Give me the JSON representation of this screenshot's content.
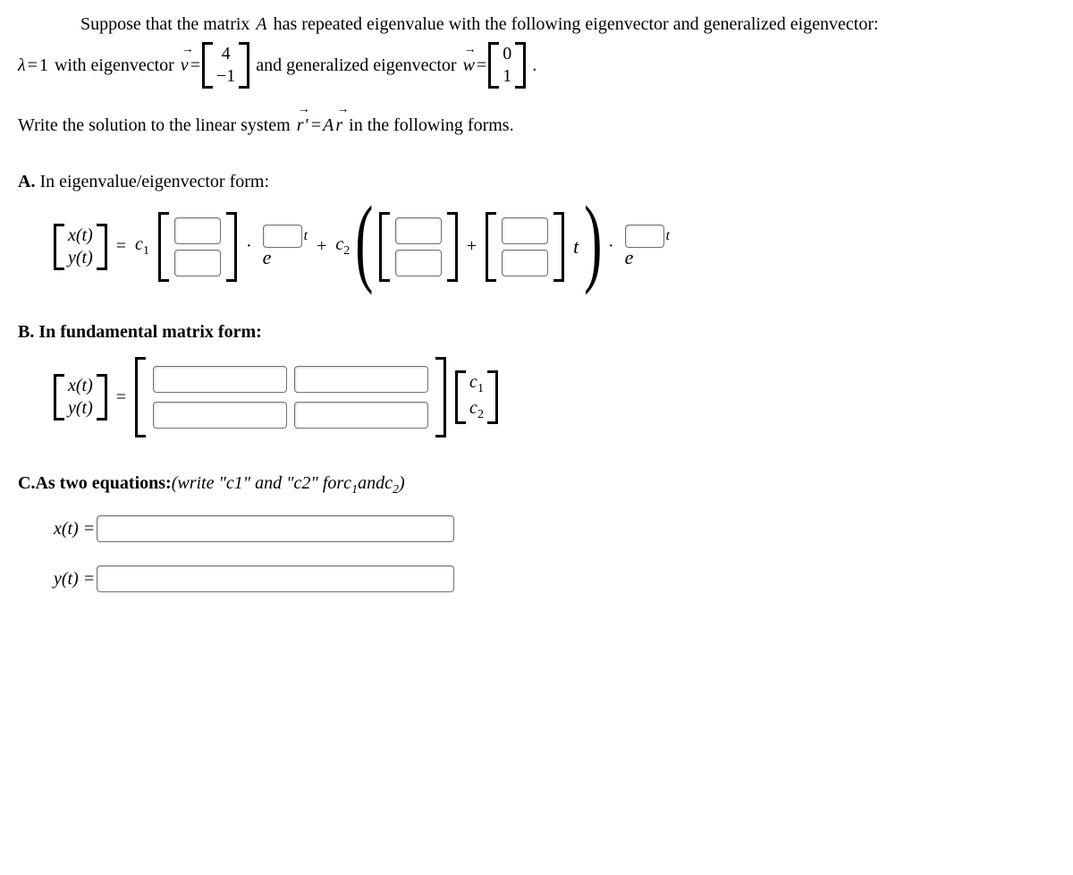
{
  "intro": {
    "l1a": "Suppose that the matrix ",
    "A": "A",
    "l1b": " has repeated eigenvalue with the following eigenvector and generalized eigenvector:",
    "lambda": "λ",
    "eq": " = ",
    "one": "1",
    "witheig": " with eigenvector ",
    "v": "v",
    "eq2": " = ",
    "v1": "4",
    "v2": "−1",
    "andgen": " and generalized eigenvector ",
    "w": "w",
    "eq3": " = ",
    "w1": "0",
    "w2": "1",
    "dot": " ."
  },
  "write": {
    "a": "Write the solution to the linear system ",
    "r": "r",
    "prime": " ′",
    "eq": " = ",
    "Ar": "A",
    "r2": "r",
    "b": " in the following forms."
  },
  "partA": {
    "head_bold": "A.",
    "head_rest": " In eigenvalue/eigenvector form:",
    "x": "x(t)",
    "y": "y(t)",
    "eq": " = ",
    "c1": "c",
    "c1s": "1",
    "dot": " · ",
    "e": "e",
    "t": "t",
    "plus": " + ",
    "c2": "c",
    "c2s": "2",
    "plusin": " + ",
    "tmid": "t"
  },
  "partB": {
    "head_bold": "B.",
    "head_rest": " In fundamental matrix form:",
    "x": "x(t)",
    "y": "y(t)",
    "eq": " = ",
    "c1": "c",
    "c1s": "1",
    "c2": "c",
    "c2s": "2"
  },
  "partC": {
    "head_bold": "C.",
    "head_rest1": " As two equations: ",
    "head_rest2": "(write \"c1\" and \"c2\" for ",
    "c1": "c",
    "c1s": "1",
    "and": " and ",
    "c2": "c",
    "c2s": "2",
    "close": " )",
    "xt": "x(t) = ",
    "yt": "y(t) = "
  }
}
